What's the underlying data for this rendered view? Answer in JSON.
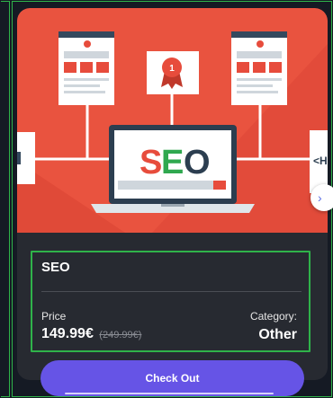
{
  "product": {
    "title": "SEO",
    "hero_text": "SEO",
    "hero_colors": {
      "background": "#e74c3c",
      "s": "#e74c3c",
      "e": "#2fa84f",
      "o": "#2c3e50"
    },
    "price_label": "Price",
    "price_current": "149.99€",
    "price_original": "(249.99€)",
    "category_label": "Category:",
    "category_value": "Other",
    "badge_number": "1",
    "side_code_text": "<H"
  },
  "actions": {
    "checkout_label": "Check Out",
    "next_icon": "chevron-right-icon"
  },
  "colors": {
    "frame_outline": "#2fb34a",
    "card_bg": "#272a31",
    "button_bg": "#6654e6"
  }
}
